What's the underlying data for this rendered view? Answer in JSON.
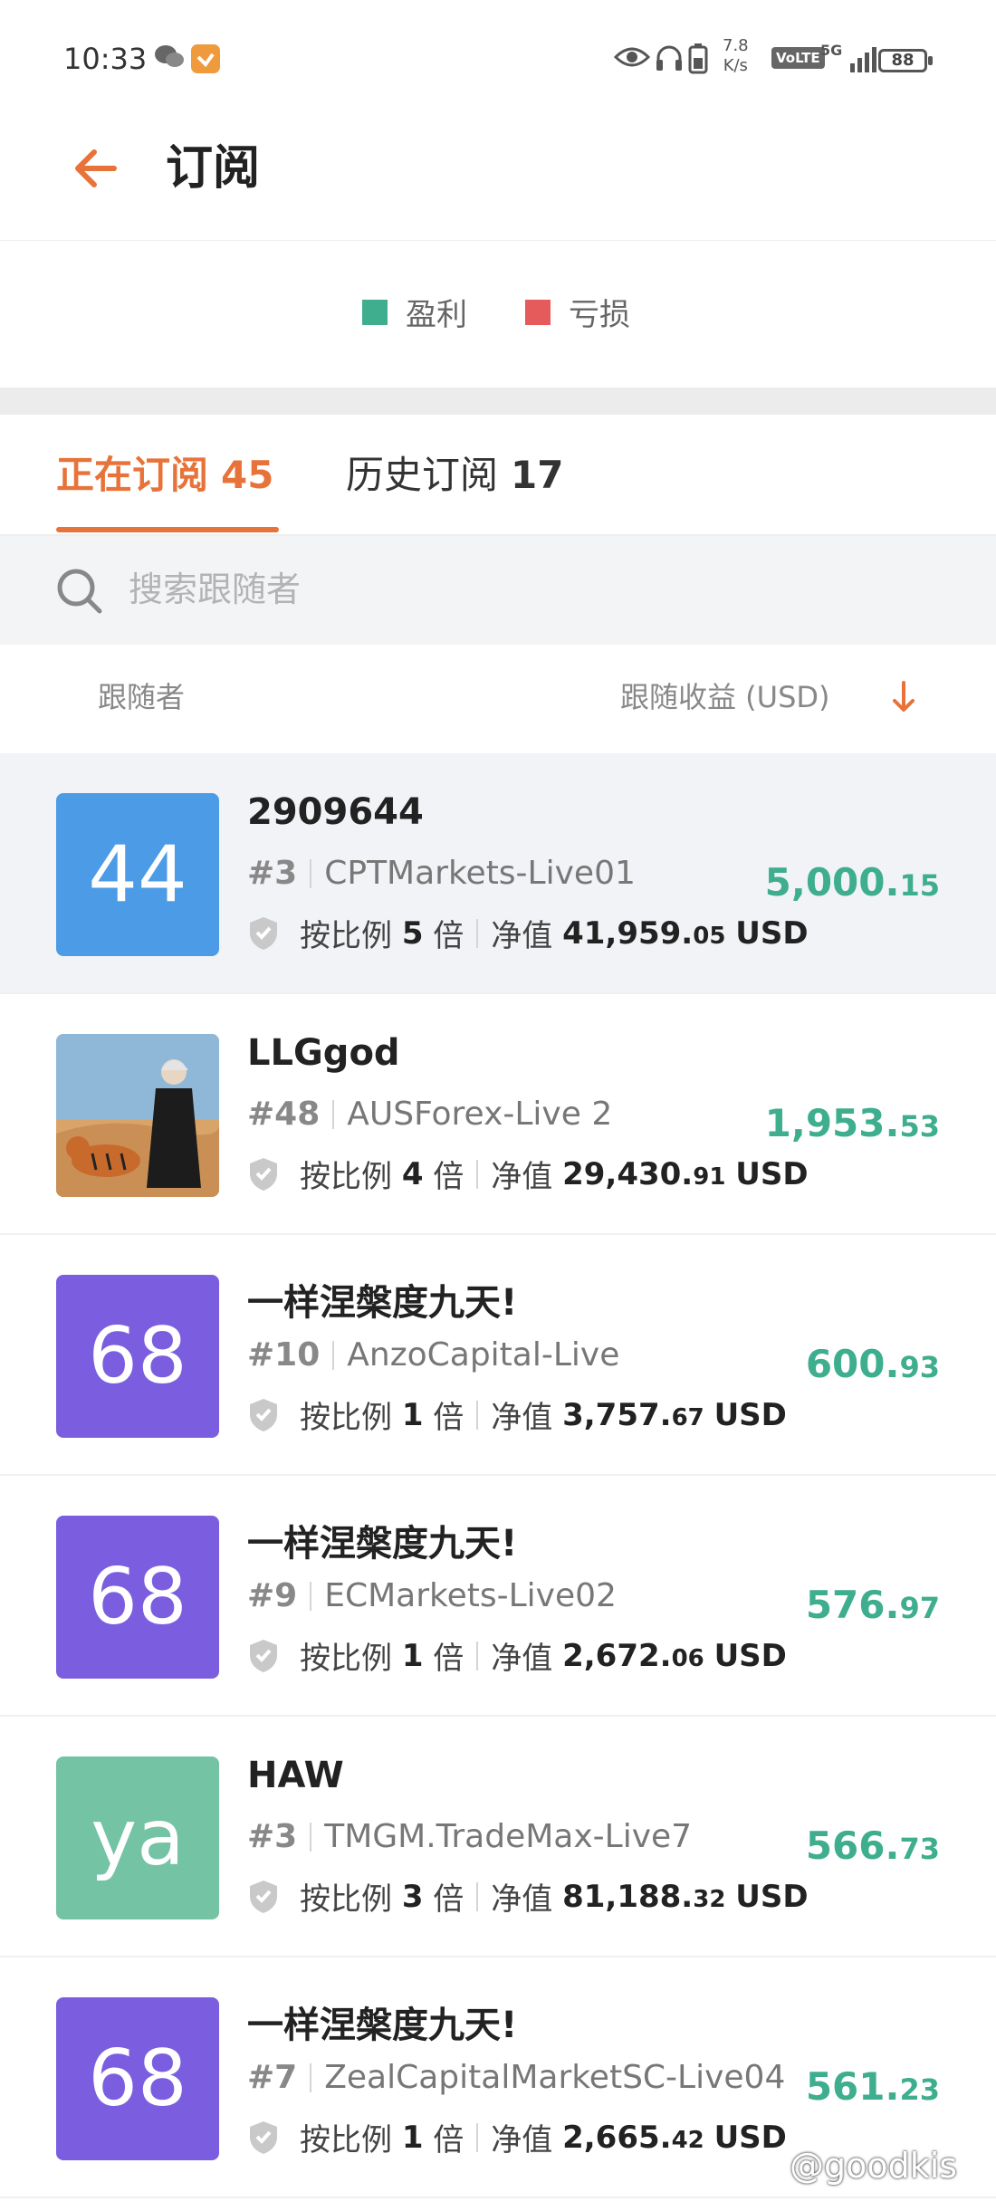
{
  "status_bar": {
    "time": "10:33",
    "speed_value": "7.8",
    "speed_unit": "K/s",
    "volte": "VoLTE",
    "network": "5G",
    "battery": "88"
  },
  "header": {
    "title": "订阅",
    "back_icon": "arrow-left-icon"
  },
  "legend": {
    "items": [
      {
        "label": "盈利",
        "color": "#3eae8e"
      },
      {
        "label": "亏损",
        "color": "#e55a5a"
      }
    ]
  },
  "tabs": [
    {
      "label": "正在订阅",
      "count": "45",
      "active": true
    },
    {
      "label": "历史订阅",
      "count": "17",
      "active": false
    }
  ],
  "search": {
    "placeholder": "搜索跟随者"
  },
  "columns": {
    "left": "跟随者",
    "right": "跟随收益 (USD)"
  },
  "colors": {
    "accent": "#e8733a",
    "profit": "#3eae8e"
  },
  "followers": [
    {
      "avatar_text": "44",
      "avatar_color": "#4b9be6",
      "name": "2909644",
      "rank": "#3",
      "account": "CPTMarkets-Live01",
      "ratio_label": "按比例",
      "ratio_value": "5",
      "ratio_unit": "倍",
      "equity_label": "净值",
      "equity_main": "41,959.",
      "equity_decimal": "05",
      "equity_currency": "USD",
      "profit_main": "5,000.",
      "profit_decimal": "15"
    },
    {
      "avatar_text": "",
      "avatar_color": "#d9a46a",
      "name": "LLGgod",
      "rank": "#48",
      "account": "AUSForex-Live 2",
      "ratio_label": "按比例",
      "ratio_value": "4",
      "ratio_unit": "倍",
      "equity_label": "净值",
      "equity_main": "29,430.",
      "equity_decimal": "91",
      "equity_currency": "USD",
      "profit_main": "1,953.",
      "profit_decimal": "53"
    },
    {
      "avatar_text": "68",
      "avatar_color": "#7b5ee0",
      "name": "一样涅槃度九天!",
      "rank": "#10",
      "account": "AnzoCapital-Live",
      "ratio_label": "按比例",
      "ratio_value": "1",
      "ratio_unit": "倍",
      "equity_label": "净值",
      "equity_main": "3,757.",
      "equity_decimal": "67",
      "equity_currency": "USD",
      "profit_main": "600.",
      "profit_decimal": "93"
    },
    {
      "avatar_text": "68",
      "avatar_color": "#7b5ee0",
      "name": "一样涅槃度九天!",
      "rank": "#9",
      "account": "ECMarkets-Live02",
      "ratio_label": "按比例",
      "ratio_value": "1",
      "ratio_unit": "倍",
      "equity_label": "净值",
      "equity_main": "2,672.",
      "equity_decimal": "06",
      "equity_currency": "USD",
      "profit_main": "576.",
      "profit_decimal": "97"
    },
    {
      "avatar_text": "ya",
      "avatar_color": "#74c3a5",
      "name": "HAW",
      "rank": "#3",
      "account": "TMGM.TradeMax-Live7",
      "ratio_label": "按比例",
      "ratio_value": "3",
      "ratio_unit": "倍",
      "equity_label": "净值",
      "equity_main": "81,188.",
      "equity_decimal": "32",
      "equity_currency": "USD",
      "profit_main": "566.",
      "profit_decimal": "73"
    },
    {
      "avatar_text": "68",
      "avatar_color": "#7b5ee0",
      "name": "一样涅槃度九天!",
      "rank": "#7",
      "account": "ZealCapitalMarketSC-Live04",
      "ratio_label": "按比例",
      "ratio_value": "1",
      "ratio_unit": "倍",
      "equity_label": "净值",
      "equity_main": "2,665.",
      "equity_decimal": "42",
      "equity_currency": "USD",
      "profit_main": "561.",
      "profit_decimal": "23"
    }
  ],
  "watermark": "@goodkis"
}
